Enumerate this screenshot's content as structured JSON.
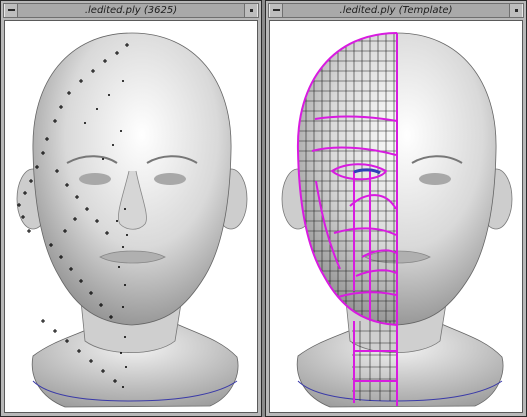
{
  "windows": [
    {
      "title": ".ledited.ply (3625)",
      "view": "Head scan with scattered point markers"
    },
    {
      "title": ".ledited.ply (Template)",
      "view": "Head scan with template grid overlay"
    }
  ],
  "colors": {
    "frame": "#b8b8b8",
    "titlebar": "#a9a9a9",
    "overlay": "#d81be0",
    "markers": "#000000",
    "canvas": "#ffffff"
  },
  "icons": [
    "window-menu-icon",
    "minimize-icon"
  ]
}
